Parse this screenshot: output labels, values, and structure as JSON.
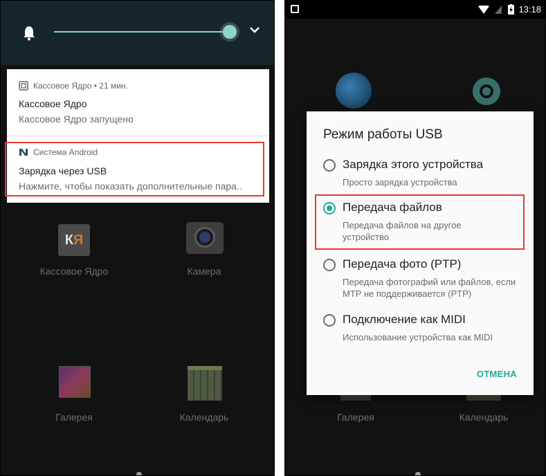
{
  "left_screen": {
    "shade": {
      "brightness_icon": "bell-icon",
      "expand_icon": "chevron-down-icon"
    },
    "notifications": [
      {
        "app_header": "Кассовое Ядро • 21 мин.",
        "title": "Кассовое Ядро",
        "text": "Кассовое Ядро запущено",
        "icon": "app-square-icon"
      },
      {
        "app_header": "Система Android",
        "title": "Зарядка через USB",
        "text": "Нажмите, чтобы показать дополнительные пара..",
        "icon": "android-n-icon",
        "highlighted": true
      }
    ],
    "apps": [
      {
        "label": "Кассовое Ядро",
        "icon_text": "К⁃Я"
      },
      {
        "label": "Камера"
      },
      {
        "label": "Галерея"
      },
      {
        "label": "Календарь"
      }
    ]
  },
  "right_screen": {
    "status_bar": {
      "time": "13:18"
    },
    "dialog": {
      "title": "Режим работы USB",
      "options": [
        {
          "label": "Зарядка этого устройства",
          "desc": "Просто зарядка устройства",
          "selected": false
        },
        {
          "label": "Передача файлов",
          "desc": "Передача файлов на другое устройство",
          "selected": true
        },
        {
          "label": "Передача фото (PTP)",
          "desc": "Передача фотографий или файлов, если MTP не поддерживается (PTP)",
          "selected": false
        },
        {
          "label": "Подключение как MIDI",
          "desc": "Использование устройства как MIDI",
          "selected": false
        }
      ],
      "cancel_label": "ОТМЕНА"
    },
    "apps": [
      {
        "label": "Галерея"
      },
      {
        "label": "Календарь"
      }
    ]
  },
  "colors": {
    "accent": "#1fa89a",
    "highlight": "#e53935",
    "shade": "#17262b"
  }
}
